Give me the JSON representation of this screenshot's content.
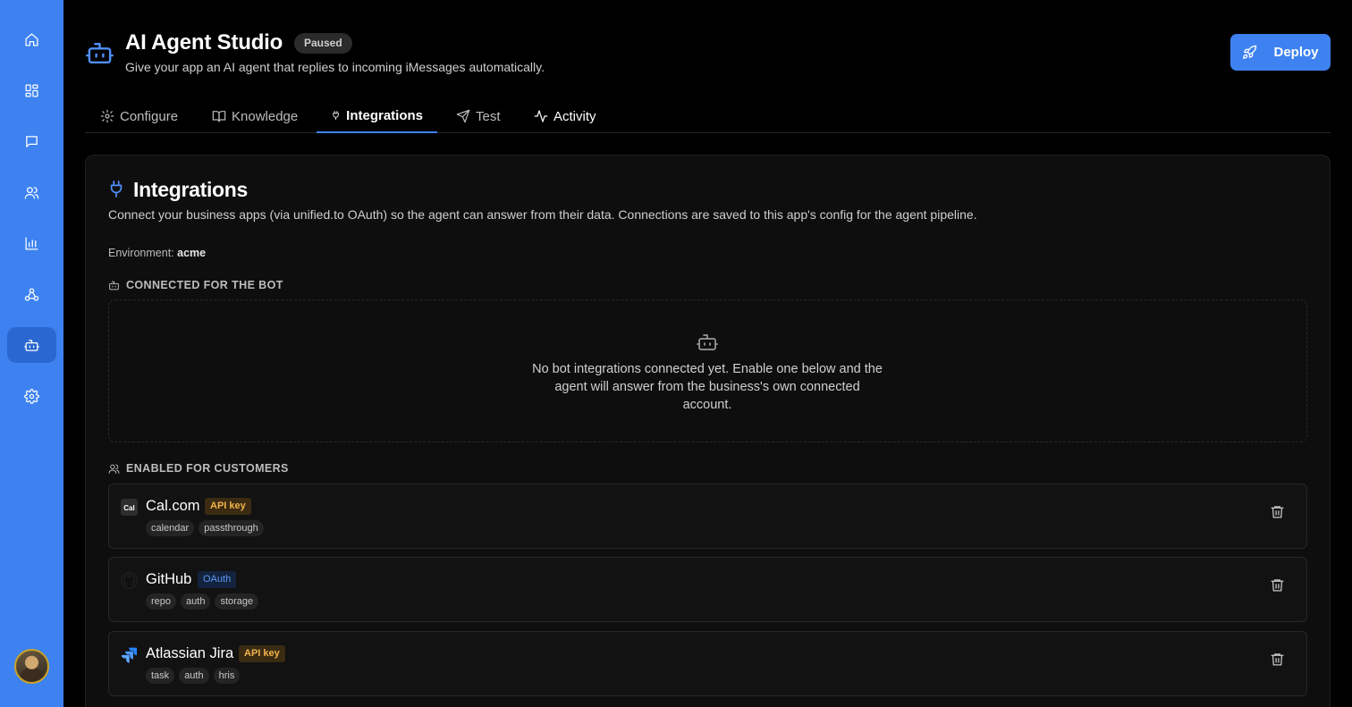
{
  "sidebar": {
    "items": [
      {
        "icon": "home-icon",
        "label": "Home"
      },
      {
        "icon": "apps-icon",
        "label": "Apps"
      },
      {
        "icon": "messages-icon",
        "label": "Messages"
      },
      {
        "icon": "users-icon",
        "label": "Contacts"
      },
      {
        "icon": "analytics-icon",
        "label": "Analytics"
      },
      {
        "icon": "webhook-icon",
        "label": "Webhooks"
      },
      {
        "icon": "bot-icon",
        "label": "AI Agent Studio",
        "active": true
      },
      {
        "icon": "settings-icon",
        "label": "Settings"
      }
    ],
    "accent_color": "#3d82f0"
  },
  "header": {
    "title": "AI Agent Studio",
    "status": "Paused",
    "subtitle": "Give your app an AI agent that replies to incoming iMessages automatically.",
    "deploy_label": "Deploy"
  },
  "tabs": [
    {
      "label": "Configure",
      "icon": "gear-icon"
    },
    {
      "label": "Knowledge",
      "icon": "book-icon"
    },
    {
      "label": "Integrations",
      "icon": "plug-icon",
      "active": true
    },
    {
      "label": "Test",
      "icon": "send-icon"
    },
    {
      "label": "Activity",
      "icon": "activity-icon"
    }
  ],
  "integrations": {
    "title": "Integrations",
    "description": "Connect your business apps (via unified.to OAuth) so the agent can answer from their data. Connections are saved to this app's config for the agent pipeline.",
    "environment_label": "Environment:",
    "environment_value": "acme",
    "bot_section": {
      "heading": "CONNECTED FOR THE BOT",
      "empty_text": "No bot integrations connected yet. Enable one below and the agent will answer from the business's own connected account."
    },
    "customer_section": {
      "heading": "ENABLED FOR CUSTOMERS",
      "items": [
        {
          "name": "Cal.com",
          "auth": "API key",
          "logo": "calcom-logo",
          "tags": [
            "calendar",
            "passthrough"
          ]
        },
        {
          "name": "GitHub",
          "auth": "OAuth",
          "logo": "github-logo",
          "tags": [
            "repo",
            "auth",
            "storage"
          ]
        },
        {
          "name": "Atlassian Jira",
          "auth": "API key",
          "logo": "jira-logo",
          "tags": [
            "task",
            "auth",
            "hris"
          ]
        }
      ]
    }
  }
}
